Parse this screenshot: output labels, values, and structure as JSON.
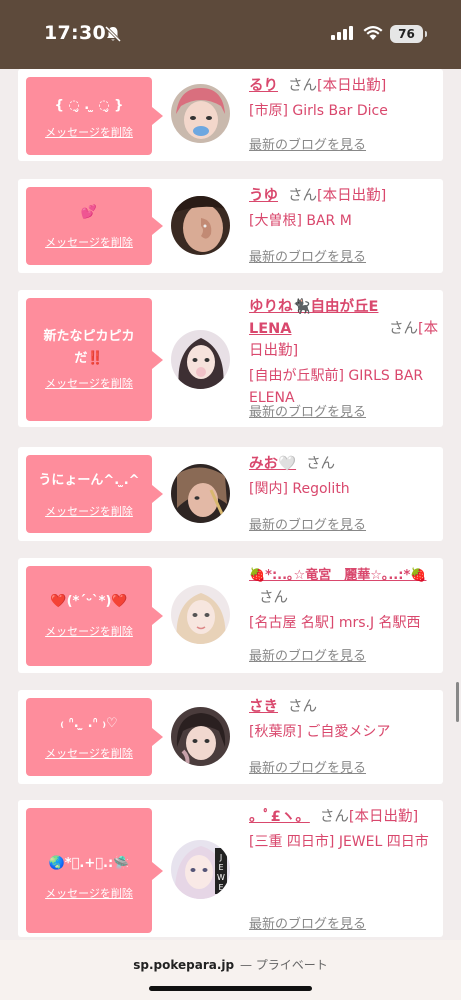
{
  "status_bar": {
    "time": "17:30",
    "battery": "76"
  },
  "delete_label": "メッセージを削除",
  "blog_label": "最新のブログを見る",
  "cards": [
    {
      "message": "{ ◌̬ . ̫ ◌̬ }",
      "name": "るり",
      "honorific": "さん",
      "status": "[本日出勤]",
      "shop": "[市原] Girls Bar Dice"
    },
    {
      "message": "💕",
      "name": "うゆ",
      "honorific": "さん",
      "status": "[本日出勤]",
      "shop": "[大曽根] BAR M"
    },
    {
      "message": "新たなピカピカだ‼️",
      "name": "ゆりね🐈‍⬛自由が丘ELENA",
      "honorific": "さん",
      "status": "[本日出勤]",
      "shop": "[自由が丘駅前] GIRLS BAR ELENA"
    },
    {
      "message": "うにょーん^. ̫.^",
      "name": "みお🤍",
      "honorific": "さん",
      "status": "",
      "shop": "[関内] Regolith"
    },
    {
      "message": "❤️(*ˊᵕˋ*)❤️",
      "name": "🍓*:..｡☆竜宮　麗華☆｡..:*🍓",
      "honorific": "さん",
      "status": "",
      "shop": "[名古屋 名駅] mrs.J 名駅西"
    },
    {
      "message": "₍ ᐢ. ̫ .ᐢ ₎♡",
      "name": "さき",
      "honorific": "さん",
      "status": "",
      "shop": "[秋葉原] ご自愛メシア"
    },
    {
      "message": "🌏*ﾟ.+ﾟ.:🛸",
      "name": "。ﾟ£ヽ。",
      "honorific": "さん",
      "status": "[本日出勤]",
      "shop": "[三重 四日市] JEWEL 四日市"
    }
  ],
  "bottom_bar": {
    "domain": "sp.pokepara.jp",
    "mode": "— プライベート"
  }
}
